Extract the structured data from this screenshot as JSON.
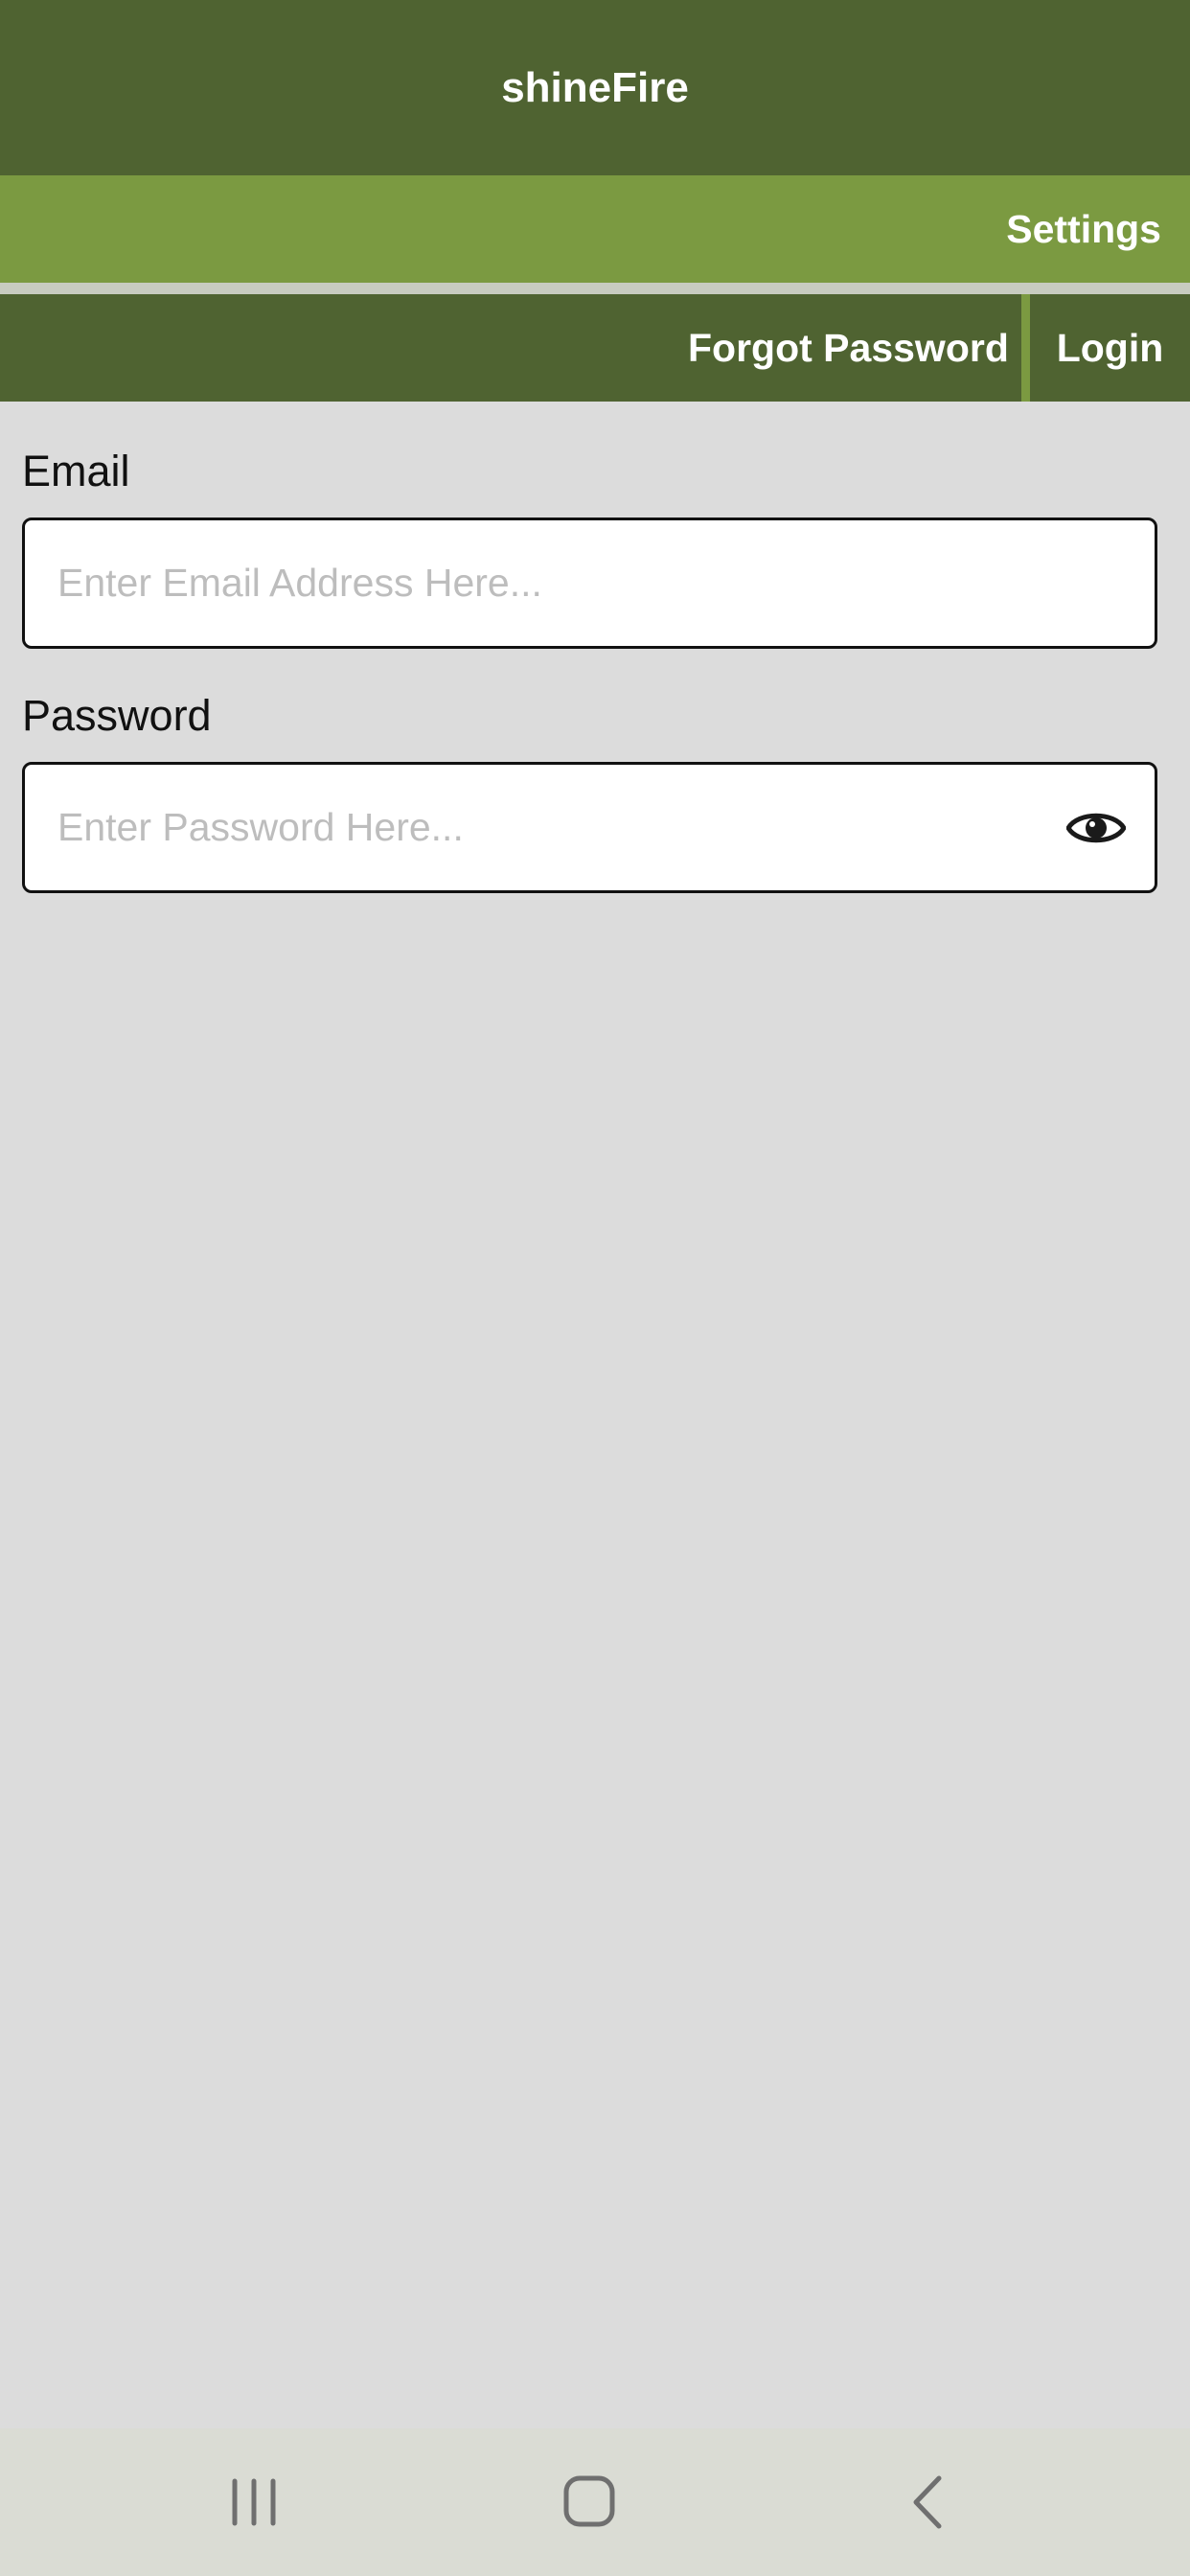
{
  "header": {
    "title": "shineFire"
  },
  "settings_bar": {
    "settings_label": "Settings"
  },
  "actions": {
    "forgot_password_label": "Forgot Password",
    "login_label": "Login"
  },
  "form": {
    "email": {
      "label": "Email",
      "placeholder": "Enter Email Address Here...",
      "value": ""
    },
    "password": {
      "label": "Password",
      "placeholder": "Enter Password Here...",
      "value": "",
      "toggle_icon": "eye-icon"
    }
  },
  "navigation_bar": {
    "buttons": [
      "recents-icon",
      "home-icon",
      "back-icon"
    ]
  },
  "colors": {
    "header": "#4f6331",
    "accent": "#7b9a41",
    "background": "#dcdcdc",
    "nav_bar": "#dadcd4"
  }
}
